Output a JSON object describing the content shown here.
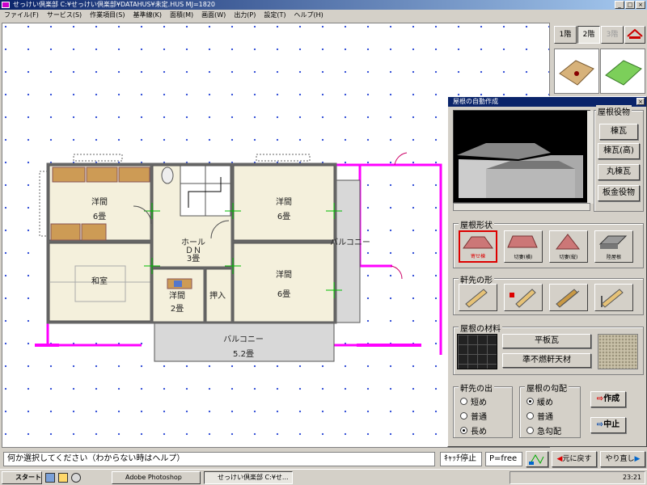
{
  "window": {
    "title": "せっけい倶楽部 C:¥せっけい倶楽部¥DATAHUS¥未定.HUS  MJ=1820"
  },
  "menu": [
    "ファイル(F)",
    "サービス(S)",
    "作業項目(S)",
    "基準線(K)",
    "面積(M)",
    "画面(W)",
    "出力(P)",
    "設定(T)",
    "ヘルプ(H)"
  ],
  "floors": {
    "tabs": [
      "1階",
      "2階",
      "3階"
    ],
    "active": "2階",
    "disabled": "3階"
  },
  "plan": {
    "rooms": [
      {
        "name": "洋間",
        "size": "6畳"
      },
      {
        "name": "洋間",
        "size": "6畳"
      },
      {
        "name": "ホール",
        "size": "3畳",
        "extra": "ＤＮ"
      },
      {
        "name": "和室",
        "size": ""
      },
      {
        "name": "洋間",
        "size": "2畳"
      },
      {
        "name": "押入",
        "size": ""
      },
      {
        "name": "洋間",
        "size": "6畳"
      },
      {
        "name": "バルコニー",
        "size": ""
      },
      {
        "name": "バルコニー",
        "size": "5.2畳"
      }
    ]
  },
  "roof_panel": {
    "title": "屋根の自動作成",
    "roof_trim": {
      "label": "屋根役物",
      "buttons": [
        "棟瓦",
        "棟瓦(高)",
        "丸棟瓦",
        "板金役物"
      ]
    },
    "roof_shape": {
      "label": "屋根形状",
      "options": [
        "寄せ棟",
        "切妻(横)",
        "切妻(縦)",
        "陸屋根"
      ],
      "selected": "寄せ棟"
    },
    "eaves_shape": {
      "label": "軒先の形"
    },
    "material": {
      "label": "屋根の材料",
      "roof_material": "平板瓦",
      "soffit_material": "準不燃軒天材"
    },
    "eaves_depth": {
      "label": "軒先の出",
      "options": [
        "短め",
        "普通",
        "長め"
      ],
      "selected": "長め"
    },
    "pitch": {
      "label": "屋根の勾配",
      "options": [
        "緩め",
        "普通",
        "急勾配"
      ],
      "selected": "緩め"
    },
    "create_label": "作成",
    "cancel_label": "中止"
  },
  "status": {
    "message": "何か選択してください（わからない時はヘルプ）",
    "snap": "ｷｬｯﾁ停止",
    "pen": "P=free",
    "undo": "元に戻す",
    "redo": "やり直し"
  },
  "taskbar": {
    "start": "スタート",
    "tasks": [
      "Adobe Photoshop",
      "せっけい倶楽部 C:¥せ..."
    ],
    "clock": "23:21"
  },
  "colors": {
    "wall_magenta": "#ff00ff",
    "selection_red": "#dd0000",
    "titlebar": "#0a246a"
  }
}
